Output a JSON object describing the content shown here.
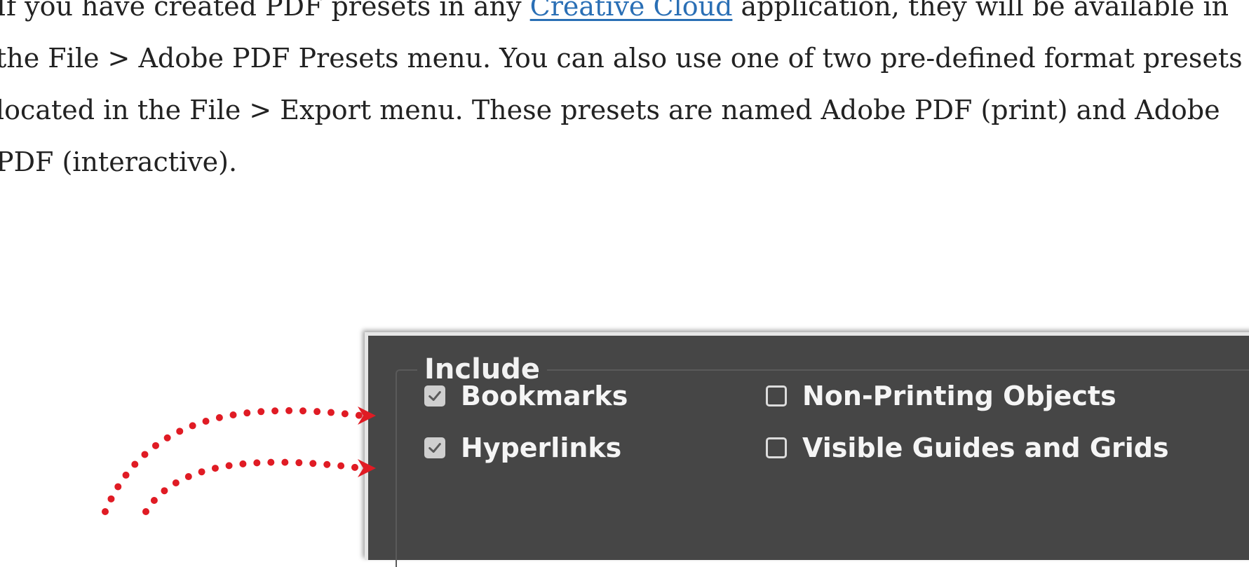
{
  "paragraph": {
    "line1_before": "If you have created PDF presets in any ",
    "link_text": "Creative Cloud",
    "line1_after": " application, they will be available in",
    "line2": "the File > Adobe PDF Presets menu. You can also use one of two pre-defined format presets",
    "line3": "located in the File > Export menu. These presets are named Adobe PDF (print) and Adobe",
    "line4": "PDF (interactive)."
  },
  "dialog": {
    "group_title": "Include",
    "options": [
      {
        "label": "Bookmarks",
        "checked": true
      },
      {
        "label": "Hyperlinks",
        "checked": true
      },
      {
        "label": "Non-Printing Objects",
        "checked": false
      },
      {
        "label": "Visible Guides and Grids",
        "checked": false
      }
    ]
  },
  "colors": {
    "link": "#2a6fb5",
    "panel_bg": "#464646",
    "arrow": "#e01b24"
  }
}
